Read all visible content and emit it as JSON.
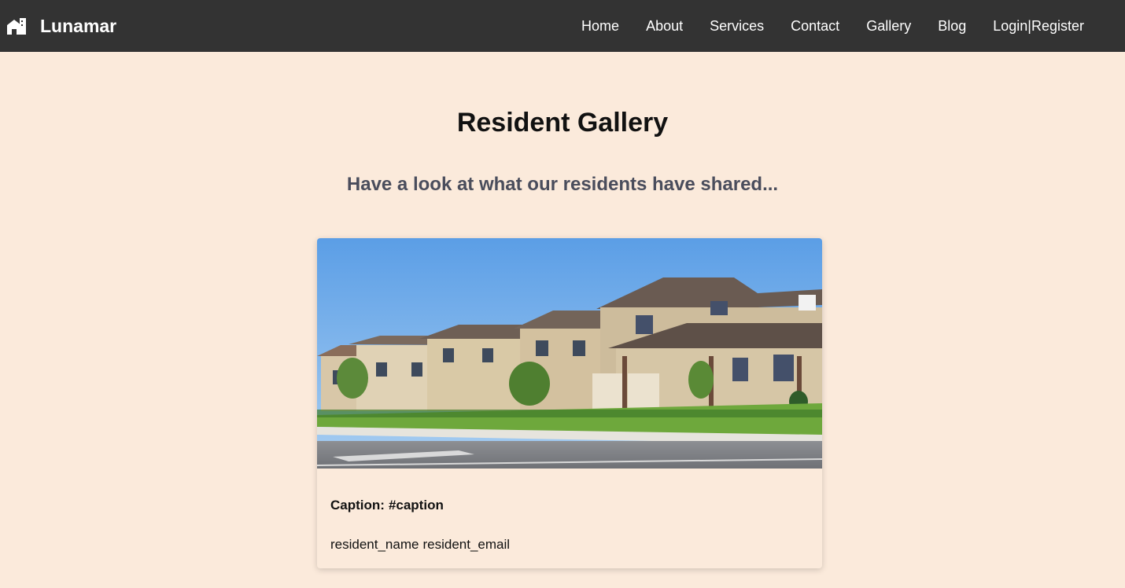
{
  "navbar": {
    "brand": "Lunamar",
    "brand_icon": "building-icon",
    "links": {
      "home": "Home",
      "about": "About",
      "services": "Services",
      "contact": "Contact",
      "gallery": "Gallery",
      "blog": "Blog"
    },
    "auth": {
      "login": "Login",
      "separator": "|",
      "register": "Register"
    },
    "background": "#333333"
  },
  "page": {
    "title": "Resident Gallery",
    "subtitle": "Have a look at what our residents have shared...",
    "background": "#fbeadb"
  },
  "gallery": {
    "cards": [
      {
        "image_icon": "suburban-houses-photo",
        "caption_label": "Caption:",
        "caption_value": "#caption",
        "resident_name": "resident_name",
        "resident_email": "resident_email"
      }
    ]
  }
}
